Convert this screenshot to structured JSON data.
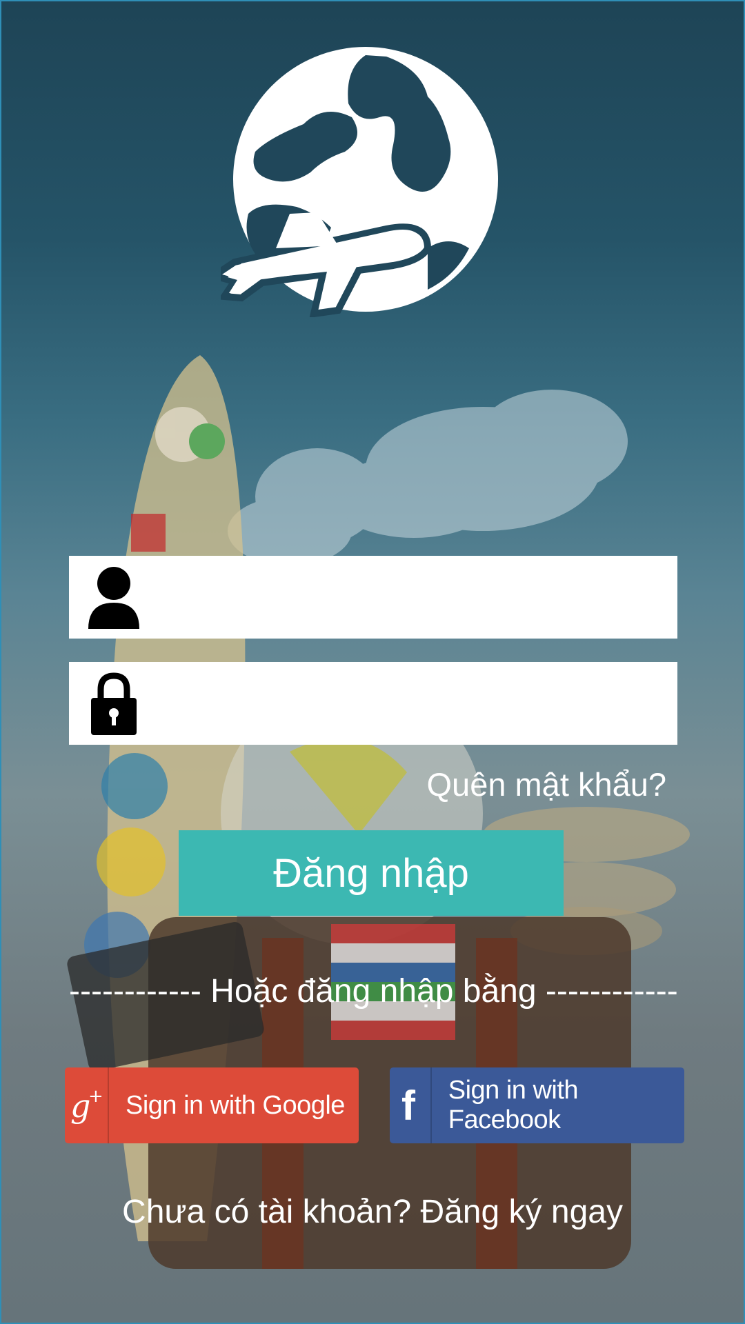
{
  "login_form": {
    "username_placeholder": "",
    "username_icon": "user-icon",
    "password_placeholder": "",
    "password_icon": "lock-icon",
    "forgot_password": "Quên mật khẩu?",
    "login_button": "Đăng nhập",
    "divider_text": "------------ Hoặc đăng nhập bằng ------------",
    "register_prompt": "Chưa có tài khoản? Đăng ký ngay"
  },
  "social_login": {
    "google": {
      "label": "Sign in with Google",
      "icon": "google-plus-icon",
      "color": "#dd4b39"
    },
    "facebook": {
      "label": "Sign in with Facebook",
      "icon": "facebook-icon",
      "color": "#3b5998"
    }
  },
  "branding": {
    "logo": "globe-airplane-logo"
  },
  "theme": {
    "accent": "#3cb8b2",
    "input_bg": "#ffffff",
    "text_on_bg": "#ffffff"
  }
}
